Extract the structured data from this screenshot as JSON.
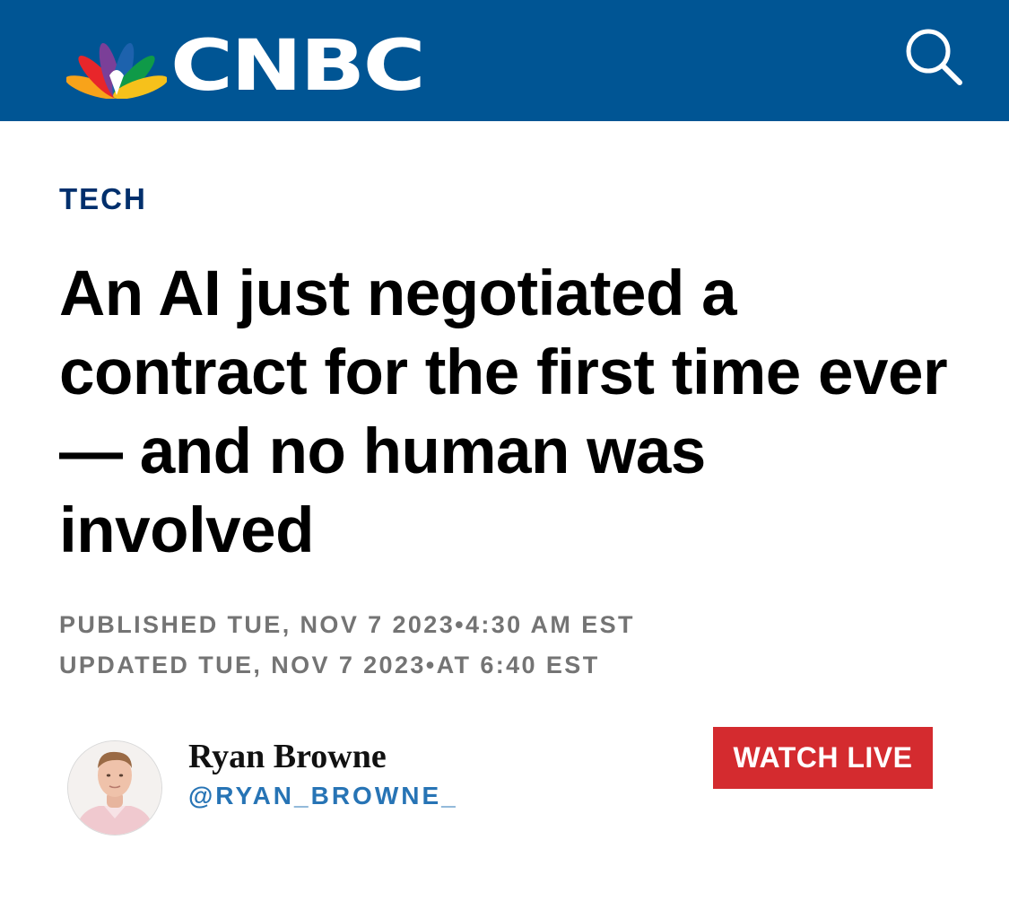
{
  "header": {
    "logo_text": "CNBC",
    "background_color": "#005594",
    "search_icon": "search-icon"
  },
  "article": {
    "section": "TECH",
    "headline": "An AI just negotiated a contract for the first time ever — and no human was involved",
    "published": "PUBLISHED TUE, NOV 7 2023•4:30 AM EST",
    "updated": "UPDATED TUE, NOV 7 2023•AT 6:40 EST"
  },
  "author": {
    "name": "Ryan Browne",
    "handle": "@RYAN_BROWNE_",
    "avatar_icon": "author-photo"
  },
  "cta": {
    "watch_live_label": "WATCH LIVE",
    "color": "#d42b2f"
  },
  "colors": {
    "section": "#002f6c",
    "headline": "#000000",
    "dates": "#747474",
    "handle": "#2774b5"
  }
}
